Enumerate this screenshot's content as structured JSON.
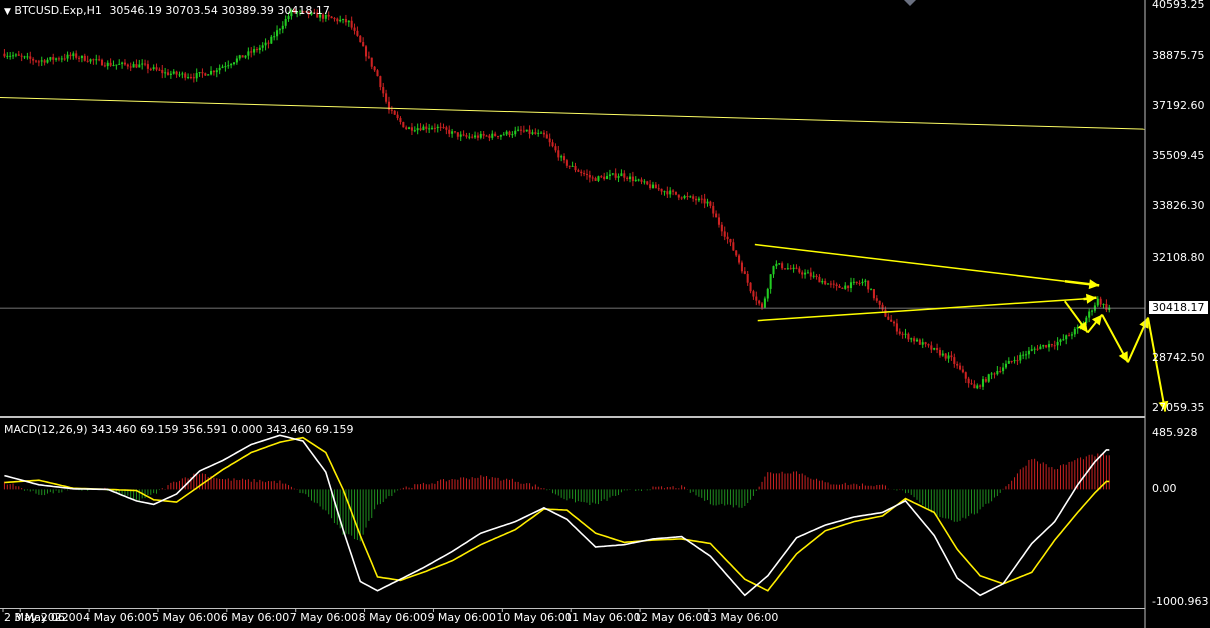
{
  "header": {
    "symbol": "BTCUSD.Exp,H1",
    "ohlc": "30546.19 30703.54 30389.39 30418.17"
  },
  "macd": {
    "title": "MACD(12,26,9) 343.460 69.159 356.591 0.000 343.460 69.159",
    "axis_labels": [
      "485.928",
      "0.00",
      "-1000.963"
    ]
  },
  "price_axis": {
    "labels": [
      "40593.25",
      "38875.75",
      "37192.60",
      "35509.45",
      "33826.30",
      "32108.80",
      "30418.17",
      "28742.50",
      "27059.35"
    ],
    "current_price": "30418.17"
  },
  "time_axis": {
    "labels": [
      "2 May 2022",
      "3 May 06:00",
      "4 May 06:00",
      "5 May 06:00",
      "6 May 06:00",
      "7 May 06:00",
      "8 May 06:00",
      "9 May 06:00",
      "10 May 06:00",
      "11 May 06:00",
      "12 May 06:00",
      "13 May 06:00"
    ]
  },
  "colors": {
    "background": "#000000",
    "bull": "#22cc22",
    "bear": "#cc2222",
    "macd_line": "#ffffff",
    "signal_line": "#ffee00",
    "trendline": "#ffff66",
    "arrow": "#ffff00",
    "grid": "#c0c0c0"
  },
  "chart_data": {
    "type": "candlestick",
    "timeframe": "H1",
    "price_range": [
      26800,
      40750
    ],
    "macd_range": [
      -1030,
      620
    ],
    "price_path": [
      [
        0,
        38950
      ],
      [
        12,
        38700
      ],
      [
        24,
        38880
      ],
      [
        36,
        38600
      ],
      [
        48,
        38550
      ],
      [
        56,
        38300
      ],
      [
        66,
        38200
      ],
      [
        72,
        38350
      ],
      [
        84,
        38900
      ],
      [
        92,
        39300
      ],
      [
        100,
        40350
      ],
      [
        108,
        40250
      ],
      [
        120,
        40000
      ],
      [
        124,
        39300
      ],
      [
        130,
        38200
      ],
      [
        134,
        37050
      ],
      [
        140,
        36450
      ],
      [
        150,
        36500
      ],
      [
        160,
        36150
      ],
      [
        170,
        36200
      ],
      [
        180,
        36350
      ],
      [
        188,
        36200
      ],
      [
        195,
        35300
      ],
      [
        205,
        34750
      ],
      [
        215,
        34900
      ],
      [
        225,
        34500
      ],
      [
        235,
        34200
      ],
      [
        245,
        33950
      ],
      [
        255,
        32200
      ],
      [
        260,
        31050
      ],
      [
        264,
        30400
      ],
      [
        268,
        31900
      ],
      [
        280,
        31550
      ],
      [
        290,
        31100
      ],
      [
        300,
        31300
      ],
      [
        306,
        30300
      ],
      [
        312,
        29600
      ],
      [
        322,
        29100
      ],
      [
        330,
        28700
      ],
      [
        338,
        27700
      ],
      [
        344,
        28200
      ],
      [
        352,
        28700
      ],
      [
        360,
        29100
      ],
      [
        368,
        29300
      ],
      [
        375,
        29800
      ],
      [
        381,
        30700
      ],
      [
        384,
        30418
      ]
    ],
    "macd_main": [
      [
        0,
        120
      ],
      [
        12,
        40
      ],
      [
        24,
        5
      ],
      [
        36,
        0
      ],
      [
        46,
        -100
      ],
      [
        52,
        -130
      ],
      [
        60,
        -40
      ],
      [
        68,
        160
      ],
      [
        76,
        250
      ],
      [
        86,
        390
      ],
      [
        96,
        470
      ],
      [
        104,
        420
      ],
      [
        112,
        150
      ],
      [
        118,
        -350
      ],
      [
        124,
        -800
      ],
      [
        130,
        -880
      ],
      [
        138,
        -780
      ],
      [
        146,
        -680
      ],
      [
        156,
        -540
      ],
      [
        166,
        -380
      ],
      [
        178,
        -280
      ],
      [
        188,
        -160
      ],
      [
        196,
        -260
      ],
      [
        206,
        -500
      ],
      [
        216,
        -480
      ],
      [
        226,
        -430
      ],
      [
        236,
        -410
      ],
      [
        246,
        -580
      ],
      [
        258,
        -920
      ],
      [
        266,
        -750
      ],
      [
        276,
        -420
      ],
      [
        286,
        -310
      ],
      [
        296,
        -240
      ],
      [
        306,
        -200
      ],
      [
        314,
        -100
      ],
      [
        324,
        -400
      ],
      [
        332,
        -770
      ],
      [
        340,
        -920
      ],
      [
        348,
        -820
      ],
      [
        358,
        -470
      ],
      [
        366,
        -280
      ],
      [
        374,
        40
      ],
      [
        380,
        240
      ],
      [
        384,
        343
      ]
    ],
    "macd_signal": [
      [
        0,
        60
      ],
      [
        12,
        80
      ],
      [
        24,
        10
      ],
      [
        36,
        0
      ],
      [
        46,
        -10
      ],
      [
        52,
        -90
      ],
      [
        60,
        -110
      ],
      [
        68,
        30
      ],
      [
        76,
        170
      ],
      [
        86,
        320
      ],
      [
        96,
        410
      ],
      [
        104,
        450
      ],
      [
        112,
        320
      ],
      [
        118,
        0
      ],
      [
        124,
        -400
      ],
      [
        130,
        -760
      ],
      [
        138,
        -790
      ],
      [
        146,
        -720
      ],
      [
        156,
        -620
      ],
      [
        166,
        -480
      ],
      [
        178,
        -350
      ],
      [
        188,
        -170
      ],
      [
        196,
        -180
      ],
      [
        206,
        -380
      ],
      [
        216,
        -460
      ],
      [
        226,
        -440
      ],
      [
        236,
        -430
      ],
      [
        246,
        -470
      ],
      [
        258,
        -780
      ],
      [
        266,
        -880
      ],
      [
        276,
        -560
      ],
      [
        286,
        -360
      ],
      [
        296,
        -280
      ],
      [
        306,
        -230
      ],
      [
        314,
        -80
      ],
      [
        324,
        -200
      ],
      [
        332,
        -520
      ],
      [
        340,
        -750
      ],
      [
        348,
        -820
      ],
      [
        358,
        -720
      ],
      [
        366,
        -440
      ],
      [
        374,
        -200
      ],
      [
        380,
        -30
      ],
      [
        384,
        69
      ]
    ],
    "current_price": 30418.17
  }
}
